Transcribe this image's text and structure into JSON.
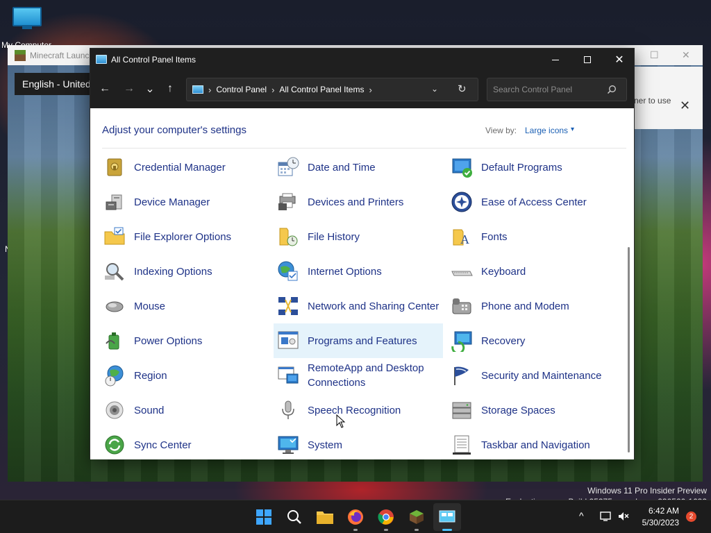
{
  "desktop": {
    "icon_label": "My Computer",
    "edge_letter": "N",
    "watermark_line1": "Windows 11 Pro Insider Preview",
    "watermark_line2": "Evaluation copy. Build 25375.zn_release.230520-1632"
  },
  "minecraft": {
    "title": "Minecraft Launcher",
    "language": "English - United",
    "banner_text": "ner to use",
    "minimize_icon": "—",
    "maximize_icon": "☐",
    "close_icon": "✕"
  },
  "window": {
    "title": "All Control Panel Items",
    "minimize_label": "Minimize",
    "maximize_label": "Maximize",
    "close_label": "✕"
  },
  "nav": {
    "back": "←",
    "forward": "→",
    "recent": "⌄",
    "up": "↑",
    "breadcrumbs": [
      "Control Panel",
      "All Control Panel Items"
    ],
    "separator": "›",
    "dropdown": "⌄",
    "refresh": "↻"
  },
  "search": {
    "placeholder": "Search Control Panel"
  },
  "content": {
    "heading": "Adjust your computer's settings",
    "view_by_label": "View by:",
    "view_by_value": "Large icons",
    "view_by_caret": "▾"
  },
  "items": [
    {
      "label": "Credential Manager",
      "icon": "credential-manager-icon"
    },
    {
      "label": "Date and Time",
      "icon": "date-time-icon"
    },
    {
      "label": "Default Programs",
      "icon": "default-programs-icon"
    },
    {
      "label": "Device Manager",
      "icon": "device-manager-icon"
    },
    {
      "label": "Devices and Printers",
      "icon": "devices-printers-icon"
    },
    {
      "label": "Ease of Access Center",
      "icon": "ease-of-access-icon"
    },
    {
      "label": "File Explorer Options",
      "icon": "file-explorer-options-icon"
    },
    {
      "label": "File History",
      "icon": "file-history-icon"
    },
    {
      "label": "Fonts",
      "icon": "fonts-icon"
    },
    {
      "label": "Indexing Options",
      "icon": "indexing-options-icon"
    },
    {
      "label": "Internet Options",
      "icon": "internet-options-icon"
    },
    {
      "label": "Keyboard",
      "icon": "keyboard-icon"
    },
    {
      "label": "Mouse",
      "icon": "mouse-icon"
    },
    {
      "label": "Network and Sharing Center",
      "icon": "network-sharing-icon"
    },
    {
      "label": "Phone and Modem",
      "icon": "phone-modem-icon"
    },
    {
      "label": "Power Options",
      "icon": "power-options-icon"
    },
    {
      "label": "Programs and Features",
      "icon": "programs-features-icon"
    },
    {
      "label": "Recovery",
      "icon": "recovery-icon"
    },
    {
      "label": "Region",
      "icon": "region-icon"
    },
    {
      "label": "RemoteApp and Desktop Connections",
      "icon": "remoteapp-icon"
    },
    {
      "label": "Security and Maintenance",
      "icon": "security-maintenance-icon"
    },
    {
      "label": "Sound",
      "icon": "sound-icon"
    },
    {
      "label": "Speech Recognition",
      "icon": "speech-recognition-icon"
    },
    {
      "label": "Storage Spaces",
      "icon": "storage-spaces-icon"
    },
    {
      "label": "Sync Center",
      "icon": "sync-center-icon"
    },
    {
      "label": "System",
      "icon": "system-icon"
    },
    {
      "label": "Taskbar and Navigation",
      "icon": "taskbar-navigation-icon"
    }
  ],
  "taskbar": {
    "apps": [
      "start-icon",
      "search-icon",
      "file-explorer-icon",
      "firefox-icon",
      "chrome-icon",
      "minecraft-icon",
      "control-panel-icon"
    ],
    "tray_chevron": "^",
    "time": "6:42 AM",
    "date": "5/30/2023",
    "notification_count": "2"
  }
}
